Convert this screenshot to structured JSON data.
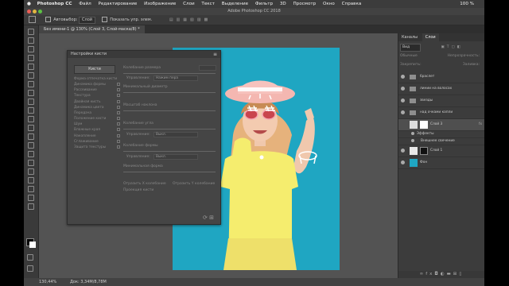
{
  "menubar": {
    "apple": "",
    "app_name": "Photoshop CC",
    "items": [
      "Файл",
      "Редактирование",
      "Изображение",
      "Слои",
      "Текст",
      "Выделение",
      "Фильтр",
      "3D",
      "Просмотр",
      "Окно",
      "Справка"
    ],
    "status_right": "100 %"
  },
  "window": {
    "title": "Adobe Photoshop CC 2018"
  },
  "options": {
    "autoselect_label": "Автовыбор:",
    "autoselect_value": "Слой",
    "show_controls_label": "Показать упр. элем."
  },
  "document": {
    "tab_title": "Без имени-1 @ 130% (Слой 3, Слой-маска/8) *"
  },
  "status": {
    "zoom": "130,44%",
    "doc_info": "Док: 3,34M/8,78M"
  },
  "brush_panel": {
    "title": "Настройки кисти",
    "brush_button": "Кисти",
    "options": [
      "Форма отпечатка кисти",
      "Динамика формы",
      "Рассеивание",
      "Текстура",
      "Двойная кисть",
      "Динамика цвета",
      "Передача",
      "Положение кисти",
      "Шум",
      "Влажные края",
      "Накопление",
      "Сглаживание",
      "Защита текстуры"
    ],
    "right_rows": {
      "r1": "Колебание размера",
      "r2_label": "Управление:",
      "r2_value": "Нажим пера",
      "r3": "Минимальный диаметр",
      "r4": "Масштаб наклона",
      "r5": "Колебание угла",
      "r6_label": "Управление:",
      "r6_value": "Выкл.",
      "r7": "Колебание формы",
      "r8_label": "Управление:",
      "r8_value": "Выкл.",
      "r9": "Минимальная форма",
      "r10a": "Отразить X колебание",
      "r10b": "Отразить Y колебание",
      "r11": "Проекция кисти"
    }
  },
  "panels": {
    "tabs": [
      "Каналы",
      "Слои"
    ],
    "filter_kind": "Вид",
    "blend_mode": "Обычные",
    "opacity_label": "Непрозрачность:",
    "lock_label": "Закрепить:",
    "fill_label": "Заливка:",
    "layers": [
      {
        "name": "браслет",
        "type": "group"
      },
      {
        "name": "линии на волосах",
        "type": "group"
      },
      {
        "name": "звезды",
        "type": "group"
      },
      {
        "name": "над очками капли",
        "type": "group"
      },
      {
        "name": "Слой 3",
        "type": "masked",
        "fx": "fx"
      },
      {
        "name": "Эффекты",
        "type": "sub"
      },
      {
        "name": "Внешнее свечение",
        "type": "sub"
      },
      {
        "name": "Слой 1",
        "type": "masked-dark"
      },
      {
        "name": "Фон",
        "type": "fill",
        "color": "#1fa6c2"
      }
    ]
  },
  "colors": {
    "canvas_bg": "#1fa6c2",
    "ui_dark": "#3c3c3c",
    "ui_mid": "#535353"
  }
}
